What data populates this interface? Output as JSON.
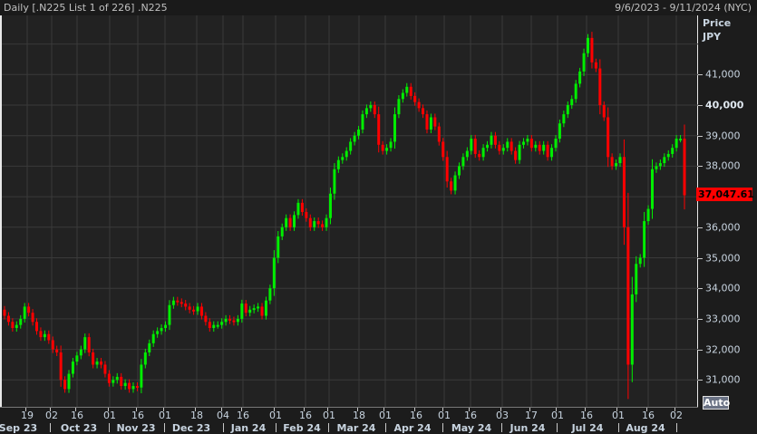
{
  "header": {
    "title": "Daily [.N225 List 1 of 226] .N225",
    "range": "9/6/2023 - 9/11/2024 (NYC)"
  },
  "price_axis": {
    "title": "Price",
    "currency": "JPY",
    "labels": [
      "41,000",
      "40,000",
      "39,000",
      "38,000",
      "36,000",
      "35,000",
      "34,000",
      "33,000",
      "32,000",
      "31,000"
    ],
    "last_price": "37,047.61",
    "auto_label": "Auto"
  },
  "colors": {
    "up": "#00ee00",
    "down": "#ff0000",
    "last_price_bg": "#ff0000"
  },
  "x_axis": {
    "days": [
      "19",
      "02",
      "16",
      "01",
      "16",
      "01",
      "18",
      "04",
      "16",
      "01",
      "16",
      "01",
      "18",
      "01",
      "16",
      "01",
      "16",
      "03",
      "17",
      "01",
      "16",
      "01",
      "16",
      "02"
    ],
    "months": [
      "Sep 23",
      "Oct 23",
      "Nov 23",
      "Dec 23",
      "Jan 24",
      "Feb 24",
      "Mar 24",
      "Apr 24",
      "May 24",
      "Jun 24",
      "Jul 24",
      "Aug 24"
    ]
  },
  "chart_data": {
    "type": "candlestick",
    "symbol": ".N225",
    "ylim": [
      30500,
      42400
    ],
    "start_open": 33300,
    "closes": [
      33100,
      32900,
      32700,
      32800,
      33000,
      33400,
      33200,
      32900,
      32600,
      32400,
      32500,
      32300,
      32000,
      31900,
      31000,
      30700,
      31200,
      31600,
      31800,
      32000,
      32400,
      31900,
      31500,
      31600,
      31500,
      31200,
      30900,
      31000,
      31100,
      30800,
      30900,
      30700,
      30800,
      30750,
      31500,
      31900,
      32200,
      32500,
      32600,
      32700,
      32800,
      33450,
      33600,
      33550,
      33500,
      33400,
      33300,
      33250,
      33400,
      33100,
      32900,
      32700,
      32800,
      32800,
      32900,
      33000,
      32950,
      32900,
      33000,
      33500,
      33200,
      33300,
      33350,
      33400,
      33100,
      33600,
      34000,
      35000,
      35700,
      36000,
      36300,
      36000,
      36400,
      36800,
      36500,
      36300,
      36000,
      36200,
      36100,
      36000,
      36300,
      37100,
      37900,
      38200,
      38300,
      38500,
      38800,
      39000,
      39200,
      39700,
      39900,
      40000,
      39700,
      38700,
      38500,
      38600,
      38800,
      39700,
      40200,
      40400,
      40600,
      40300,
      40100,
      39900,
      39700,
      39200,
      39600,
      39300,
      38800,
      38300,
      37500,
      37200,
      37700,
      38000,
      38300,
      38500,
      38900,
      38400,
      38300,
      38600,
      38700,
      39000,
      38700,
      38500,
      38600,
      38800,
      38500,
      38200,
      38700,
      38800,
      38900,
      38600,
      38700,
      38500,
      38700,
      38300,
      38600,
      38900,
      39400,
      39700,
      40000,
      40200,
      40700,
      41100,
      41700,
      42200,
      41400,
      41200,
      40000,
      39600,
      38300,
      38000,
      38100,
      38300,
      36000,
      31500,
      33800,
      34800,
      35000,
      36200,
      36600,
      37900,
      38000,
      38100,
      38300,
      38400,
      38600,
      38900,
      38900,
      37047.61
    ]
  }
}
